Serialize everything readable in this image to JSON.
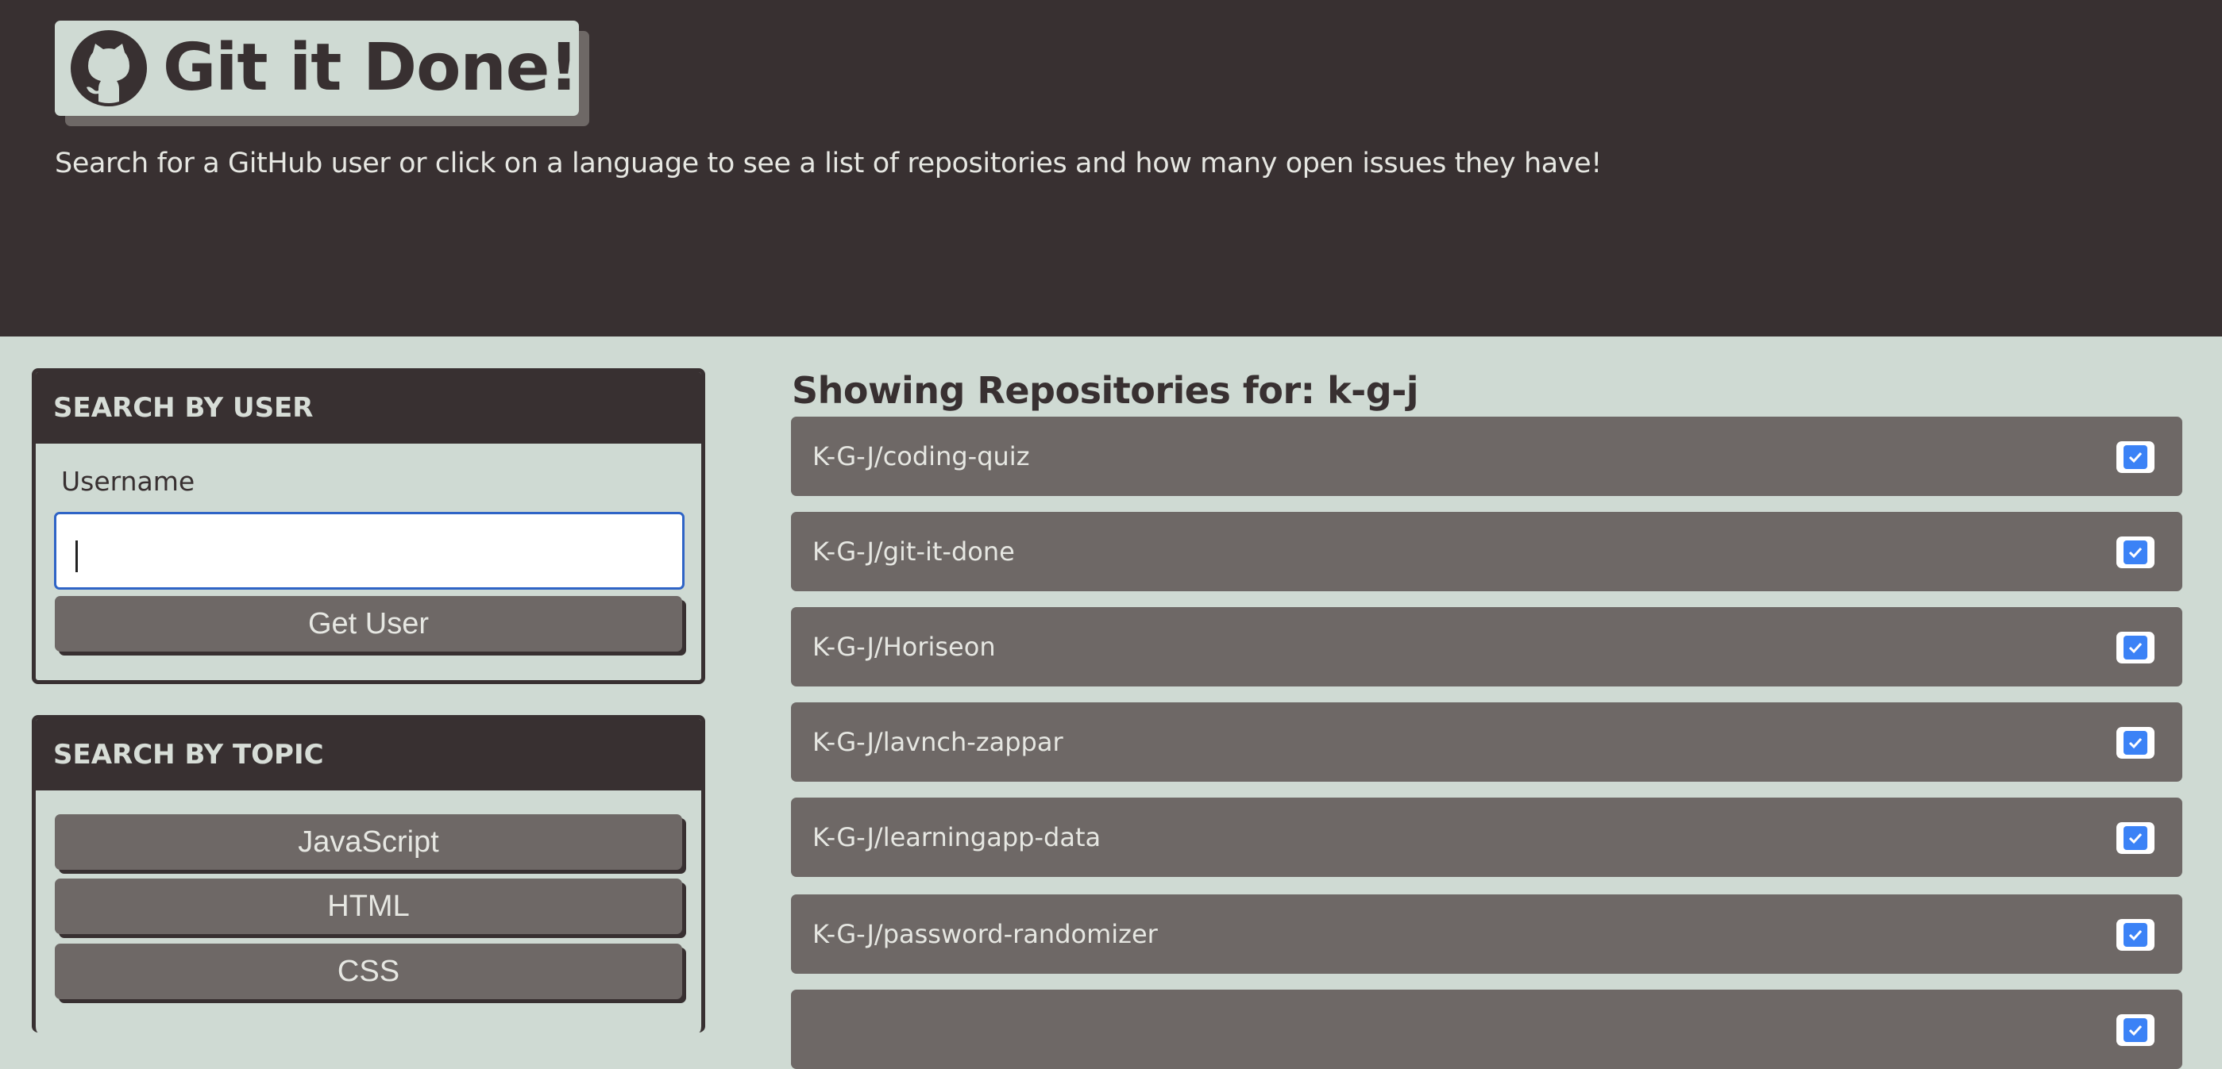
{
  "header": {
    "title": "Git it Done!",
    "subtitle": "Search for a GitHub user or click on a language to see a list of repositories and how many open issues they have!"
  },
  "user_search": {
    "heading": "SEARCH BY USER",
    "label": "Username",
    "input_value": "",
    "button_label": "Get User"
  },
  "topic_search": {
    "heading": "SEARCH BY TOPIC",
    "languages": [
      "JavaScript",
      "HTML",
      "CSS"
    ]
  },
  "repos": {
    "title": "Showing Repositories for: k-g-j",
    "items": [
      {
        "name": "K-G-J/coding-quiz",
        "status_icon": "check-square-icon"
      },
      {
        "name": "K-G-J/git-it-done",
        "status_icon": "check-square-icon"
      },
      {
        "name": "K-G-J/Horiseon",
        "status_icon": "check-square-icon"
      },
      {
        "name": "K-G-J/lavnch-zappar",
        "status_icon": "check-square-icon"
      },
      {
        "name": "K-G-J/learningapp-data",
        "status_icon": "check-square-icon"
      },
      {
        "name": "K-G-J/password-randomizer",
        "status_icon": "check-square-icon"
      },
      {
        "name": "",
        "status_icon": "check-square-icon"
      }
    ]
  },
  "colors": {
    "background": "#cfdad3",
    "dark": "#383031",
    "item": "#6e6866",
    "check": "#3b82f6",
    "input_focus": "#2f64c6"
  }
}
